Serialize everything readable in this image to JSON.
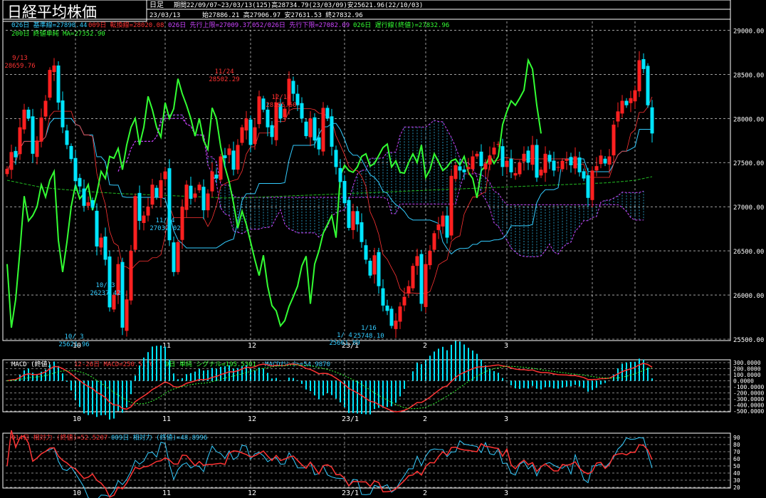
{
  "header": {
    "title": "日経平均株価",
    "period_type": "日足",
    "period_info": "期間22/09/07~23/03/13(125)高28734.79(23/03/09)安25621.96(22/10/03)",
    "last_date": "23/03/13",
    "ohlc_info": "始27886.21 高27906.97 安27631.53 終27832.96"
  },
  "legend_lines": [
    [
      {
        "text": "026日 基準線=27890.44",
        "color": "#33ccff"
      },
      {
        "text": "009日 転換線=28020.08",
        "color": "#ff3333"
      },
      {
        "text": "026日 先行上限=27009.37",
        "color": "#cc44ff"
      },
      {
        "text": "052/026日 先行下限=27082.09",
        "color": "#cc44ff"
      },
      {
        "text": "026日 遅行線(終値)=27832.96",
        "color": "#33ff33"
      }
    ],
    [
      {
        "text": "200日 終値単純 MA=27352.90",
        "color": "#33ff33"
      }
    ]
  ],
  "macd_legend": [
    {
      "text": "MACD (終値)",
      "color": "#ffffff"
    },
    {
      "text": "12-26日 MACD=250.5170",
      "color": "#ff3333"
    },
    {
      "text": "9日 単純 シグナル=195.5301",
      "color": "#33ff33"
    },
    {
      "text": "MACDｵｼﾚｰﾀｰ=54.9870",
      "color": "#33ccff"
    }
  ],
  "rsi_legend": [
    {
      "text": "014日 相対力 (終値)=52.5207",
      "color": "#ff3333"
    },
    {
      "text": "009日 相対力 (終値)=48.8996",
      "color": "#33ccff"
    }
  ],
  "colors": {
    "up_candle": "#ff2020",
    "down_candle": "#00e5ff",
    "kijun": "#33ccff",
    "tenkan": "#ff3333",
    "lagging": "#33ff33",
    "ma": "#22bb22",
    "cloud": "#cc44ff",
    "grid": "#ffffff",
    "frame": "#ffffff"
  },
  "chart_data": [
    {
      "type": "candlestick",
      "title": "日経平均株価",
      "ylim": [
        25500,
        29100
      ],
      "y_ticks": [
        "25500.00",
        "26000.00",
        "26500.00",
        "27000.00",
        "27500.00",
        "28000.00",
        "28500.00",
        "29000.00"
      ],
      "x_ticks": [
        "10",
        "11",
        "12",
        "23/1",
        "2",
        "3"
      ],
      "annotations": [
        {
          "label": "9/13",
          "value": "28659.76",
          "color": "#ff3333"
        },
        {
          "label": "11/24",
          "value": "28502.29",
          "color": "#ff3333"
        },
        {
          "label": "12/14",
          "value": "28195.50",
          "color": "#ff3333"
        },
        {
          "label": "11/ 4",
          "value": "27032.02",
          "color": "#33ccff"
        },
        {
          "label": "10/13",
          "value": "26237.42",
          "color": "#33ccff"
        },
        {
          "label": "10/ 3",
          "value": "25621.96",
          "color": "#33ccff"
        },
        {
          "label": "1/ 4",
          "value": "25661.89",
          "color": "#33ccff"
        },
        {
          "label": "1/16",
          "value": "25748.10",
          "color": "#33ccff"
        }
      ],
      "closes": [
        27430,
        27620,
        27560,
        27900,
        28100,
        28000,
        27600,
        27750,
        28010,
        28200,
        28550,
        28600,
        28180,
        27900,
        27700,
        27540,
        27290,
        27230,
        27010,
        27050,
        26990,
        26550,
        26650,
        26400,
        25860,
        26000,
        26350,
        25630,
        25950,
        26500,
        27120,
        26840,
        26900,
        27000,
        27250,
        27110,
        27300,
        27400,
        26620,
        26260,
        26600,
        27000,
        27250,
        27090,
        27150,
        27250,
        26960,
        27150,
        27400,
        27320,
        27570,
        27550,
        27660,
        27420,
        27700,
        27900,
        28000,
        27700,
        27900,
        28250,
        28100,
        27900,
        27790,
        28180,
        28000,
        28110,
        28450,
        28280,
        28150,
        28000,
        27800,
        28000,
        27750,
        27650,
        28120,
        28000,
        27680,
        27450,
        27280,
        27040,
        26760,
        26950,
        26800,
        26600,
        26400,
        26220,
        26450,
        26100,
        25880,
        25820,
        25650,
        25710,
        25870,
        25980,
        26100,
        26330,
        26440,
        25900,
        26350,
        26500,
        26700,
        26800,
        26900,
        26650,
        27350,
        27470,
        27410,
        27390,
        27450,
        27570,
        27600,
        27460,
        27490,
        27580,
        27670,
        27710,
        27450,
        27520,
        27390,
        27380,
        27500,
        27600,
        27500,
        27700,
        27330,
        27420,
        27600,
        27510,
        27410,
        27450,
        27520,
        27540,
        27470,
        27570,
        27390,
        27320,
        27100,
        27410,
        27460,
        27580,
        27490,
        27570,
        27930,
        28080,
        28200,
        28150,
        28230,
        28320,
        28660,
        28560,
        28150,
        27830
      ],
      "ma_values": [
        27300,
        27290,
        27280,
        27270,
        27260,
        27250,
        27240,
        27230,
        27220,
        27215,
        27210,
        27205,
        27200,
        27196,
        27192,
        27188,
        27184,
        27180,
        27176,
        27172,
        27168,
        27165,
        27162,
        27159,
        27156,
        27153,
        27150,
        27148,
        27146,
        27144,
        27142,
        27140,
        27138,
        27136,
        27134,
        27132,
        27130,
        27128,
        27126,
        27124,
        27122,
        27120,
        27118,
        27116,
        27114,
        27112,
        27110,
        27108,
        27106,
        27104,
        27102,
        27100,
        27100,
        27100,
        27100,
        27100,
        27102,
        27104,
        27106,
        27108,
        27110,
        27112,
        27114,
        27116,
        27118,
        27120,
        27122,
        27124,
        27126,
        27128,
        27130,
        27132,
        27134,
        27136,
        27138,
        27140,
        27142,
        27144,
        27146,
        27148,
        27150,
        27152,
        27154,
        27156,
        27158,
        27160,
        27162,
        27164,
        27166,
        27168,
        27170,
        27172,
        27174,
        27176,
        27178,
        27180,
        27182,
        27184,
        27186,
        27188,
        27190,
        27192,
        27194,
        27196,
        27198,
        27200,
        27202,
        27204,
        27206,
        27208,
        27210,
        27212,
        27214,
        27216,
        27218,
        27220,
        27222,
        27224,
        27226,
        27228,
        27230,
        27232,
        27234,
        27236,
        27238,
        27240,
        27242,
        27244,
        27246,
        27248,
        27250,
        27252,
        27254,
        27256,
        27258,
        27260,
        27262,
        27264,
        27266,
        27268,
        27270,
        27274,
        27278,
        27282,
        27286,
        27290,
        27295,
        27300,
        27310,
        27320,
        27330,
        27340
      ]
    },
    {
      "type": "line",
      "title": "MACD (終値)",
      "y_ticks": [
        "300.0000",
        "200.0000",
        "100.0000",
        "0.0000",
        "-100.0000",
        "-200.0000",
        "-300.0000",
        "-400.0000",
        "-500.0000"
      ],
      "ylim": [
        -500,
        300
      ]
    },
    {
      "type": "line",
      "title": "相対力 (終値)",
      "y_ticks": [
        "90",
        "80",
        "70",
        "60",
        "50",
        "40",
        "30",
        "20"
      ],
      "ylim": [
        20,
        90
      ]
    }
  ]
}
